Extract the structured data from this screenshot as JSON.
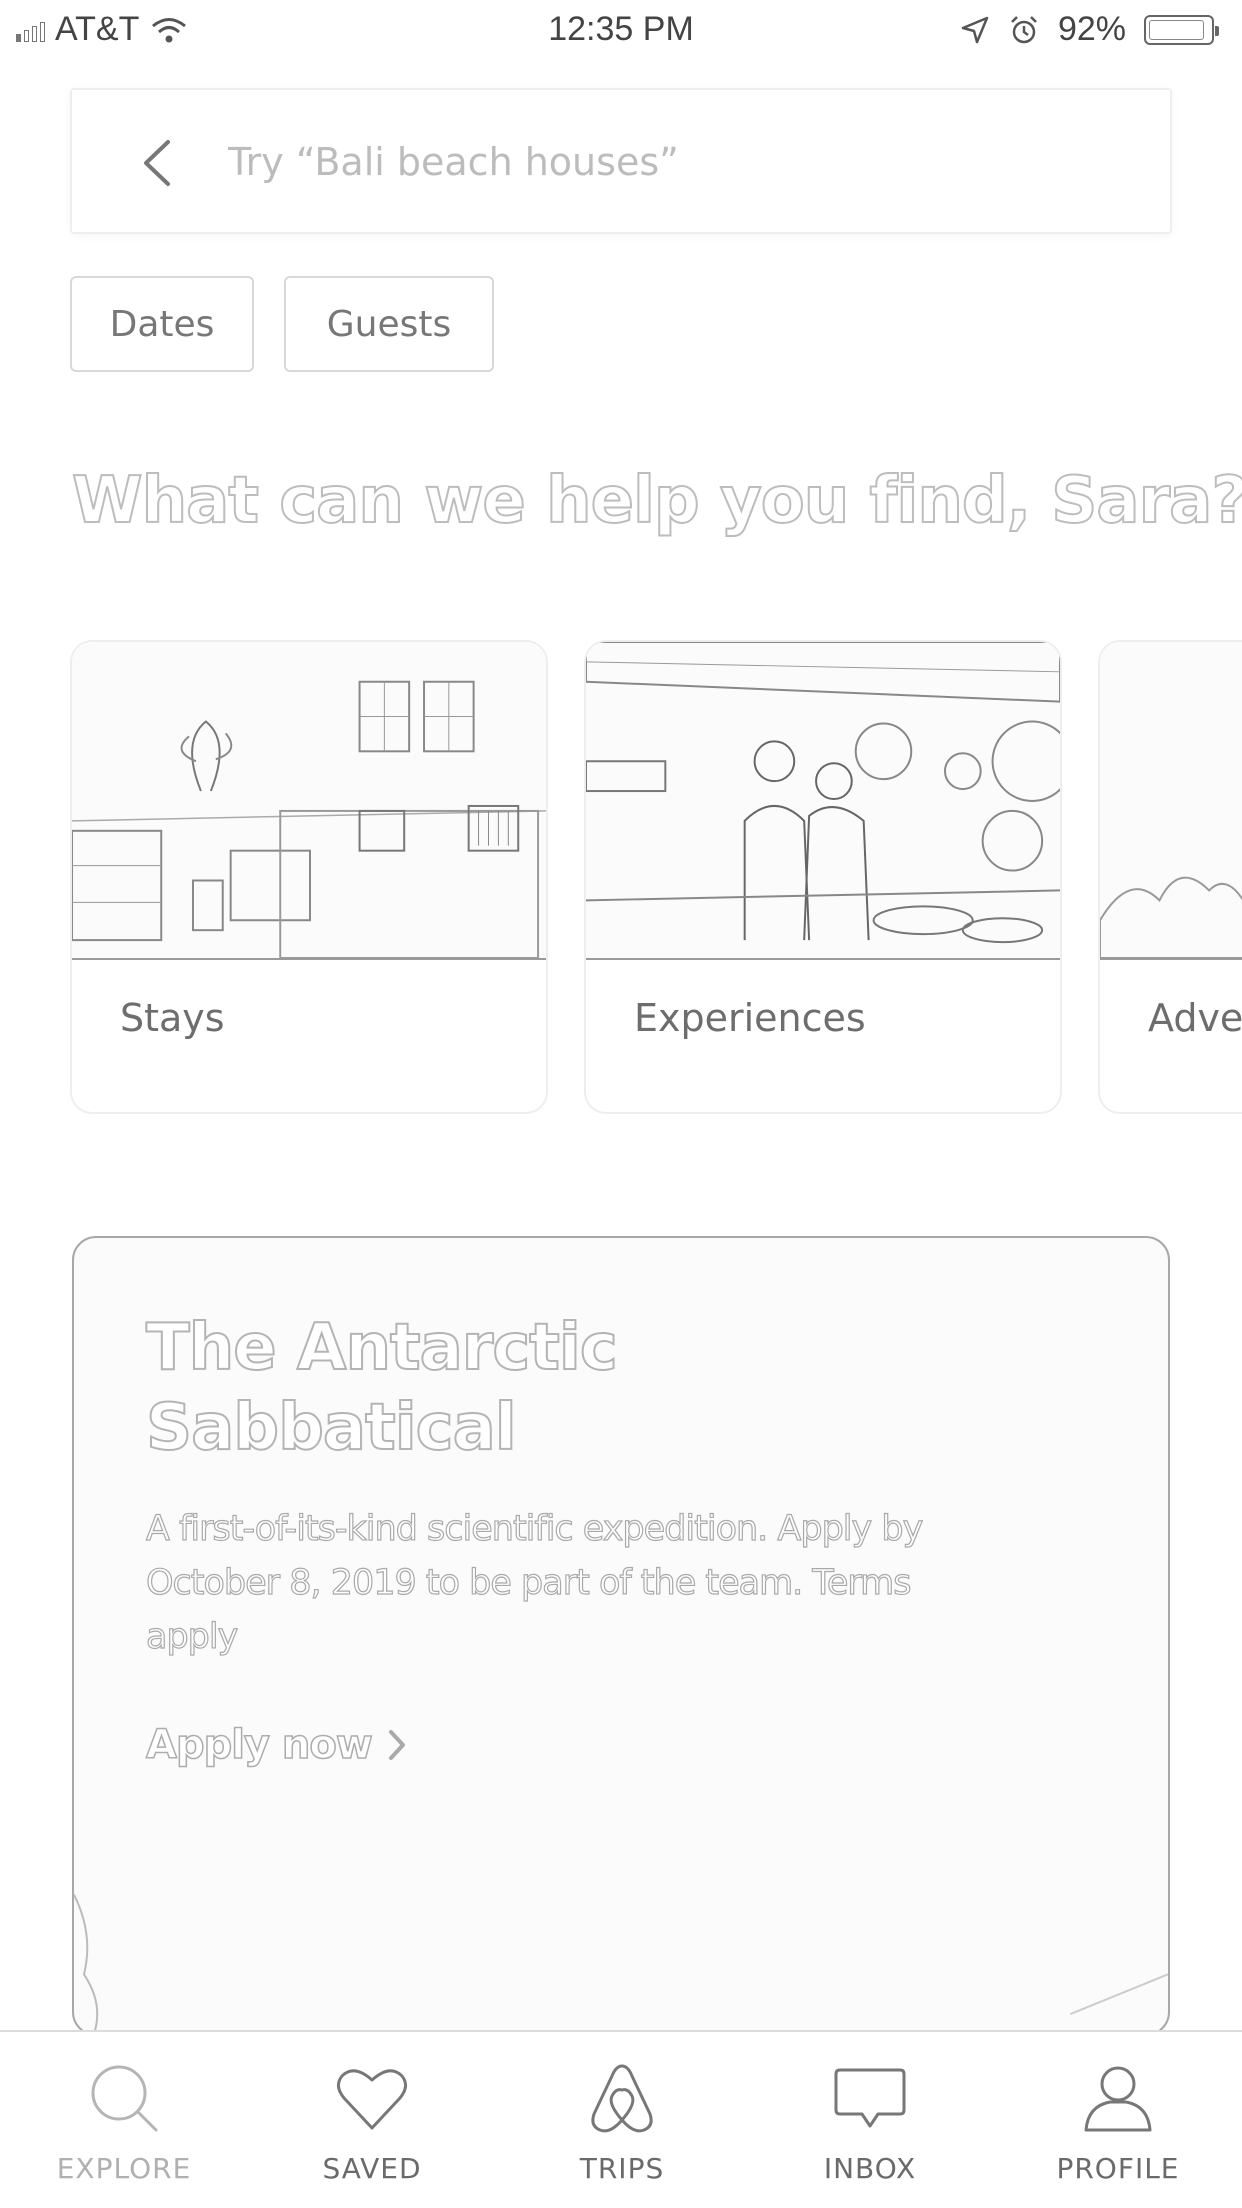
{
  "status_bar": {
    "carrier": "AT&T",
    "time": "12:35 PM",
    "battery": "92%",
    "battery_level": 0.92
  },
  "search": {
    "placeholder": "Try “Bali beach houses”"
  },
  "filters": {
    "dates_label": "Dates",
    "guests_label": "Guests"
  },
  "greeting": "What can we help you find, Sara?",
  "categories": [
    {
      "label": "Stays"
    },
    {
      "label": "Experiences"
    },
    {
      "label": "Adve"
    }
  ],
  "promo": {
    "title": "The Antarctic Sabbatical",
    "description": "A first-of-its-kind scientific expedition. Apply by October 8, 2019 to be part of the team. Terms apply",
    "link_label": "Apply now"
  },
  "tab_bar": {
    "items": [
      {
        "label": "EXPLORE",
        "icon": "search-icon"
      },
      {
        "label": "SAVED",
        "icon": "heart-icon"
      },
      {
        "label": "TRIPS",
        "icon": "airbnb-logo-icon"
      },
      {
        "label": "INBOX",
        "icon": "chat-bubble-icon"
      },
      {
        "label": "PROFILE",
        "icon": "person-icon"
      }
    ]
  }
}
